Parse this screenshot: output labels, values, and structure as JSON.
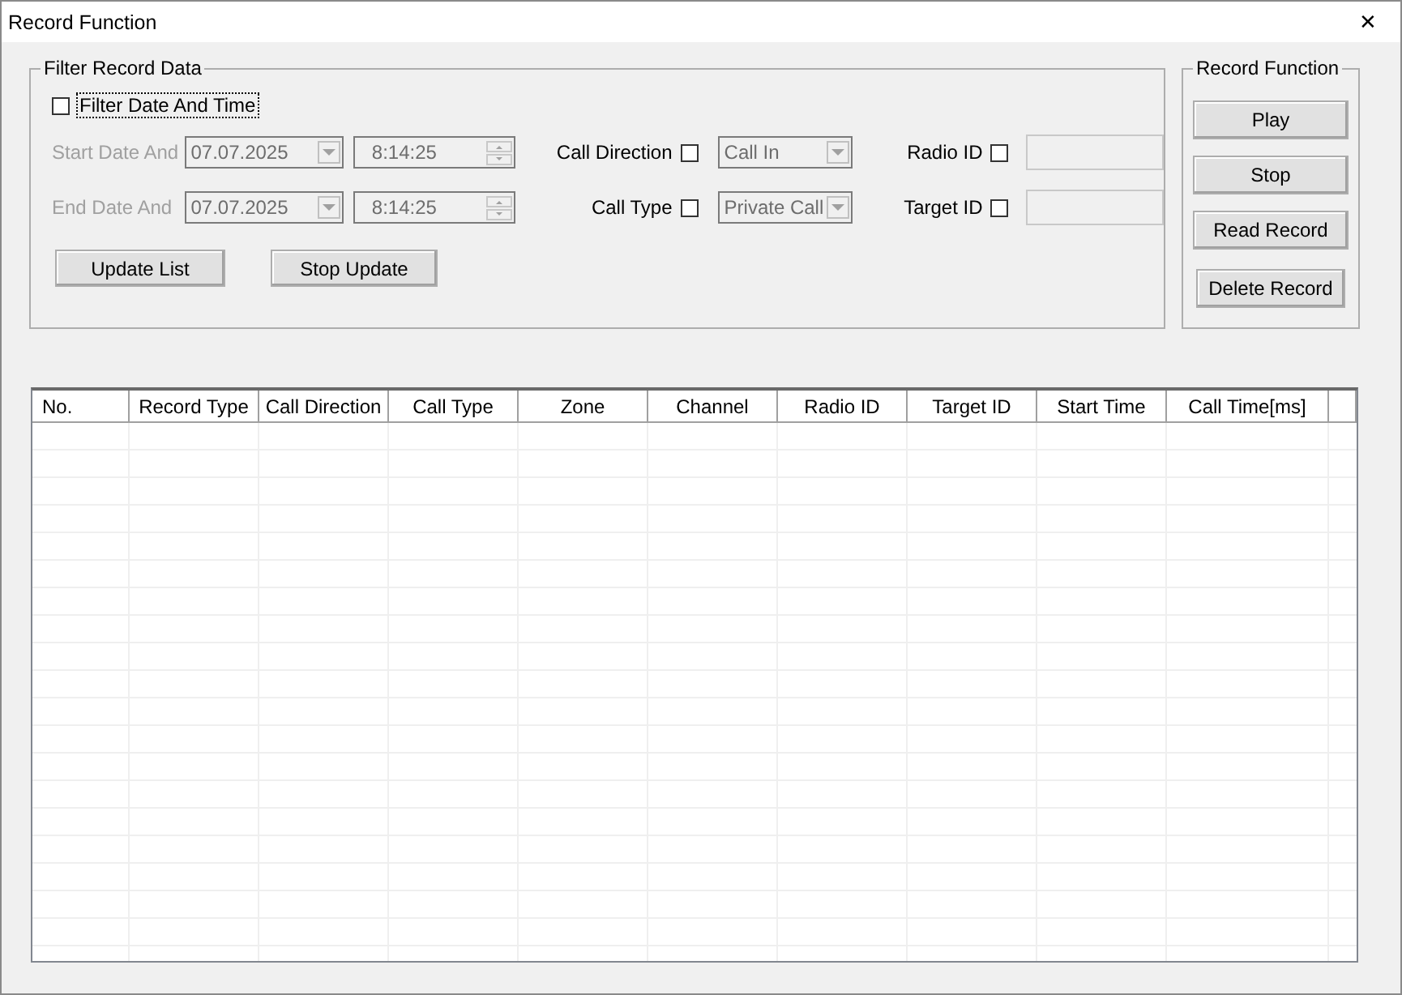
{
  "window": {
    "title": "Record Function",
    "close": "✕"
  },
  "filter_group": {
    "title": "Filter Record Data",
    "filter_date_time": {
      "label": "Filter Date And Time",
      "checked": false
    },
    "rows": [
      {
        "label": "Start Date And",
        "date": "07.07.2025",
        "time": "8:14:25",
        "disabled": true,
        "option_label": "Call Direction",
        "option_checked": false,
        "option_value": "Call In",
        "id_label": "Radio ID",
        "id_checked": false,
        "id_value": ""
      },
      {
        "label": "End Date And",
        "date": "07.07.2025",
        "time": "8:14:25",
        "disabled": true,
        "option_label": "Call Type",
        "option_checked": false,
        "option_value": "Private Call",
        "id_label": "Target ID",
        "id_checked": false,
        "id_value": ""
      }
    ],
    "buttons": [
      "Update List",
      "Stop Update"
    ]
  },
  "record_group": {
    "title": "Record Function",
    "buttons": [
      "Play",
      "Stop",
      "Read Record",
      "Delete Record"
    ]
  },
  "table": {
    "columns": [
      "No.",
      "Record Type",
      "Call Direction",
      "Call Type",
      "Zone",
      "Channel",
      "Radio ID",
      "Target ID",
      "Start Time",
      "Call Time[ms]"
    ]
  }
}
